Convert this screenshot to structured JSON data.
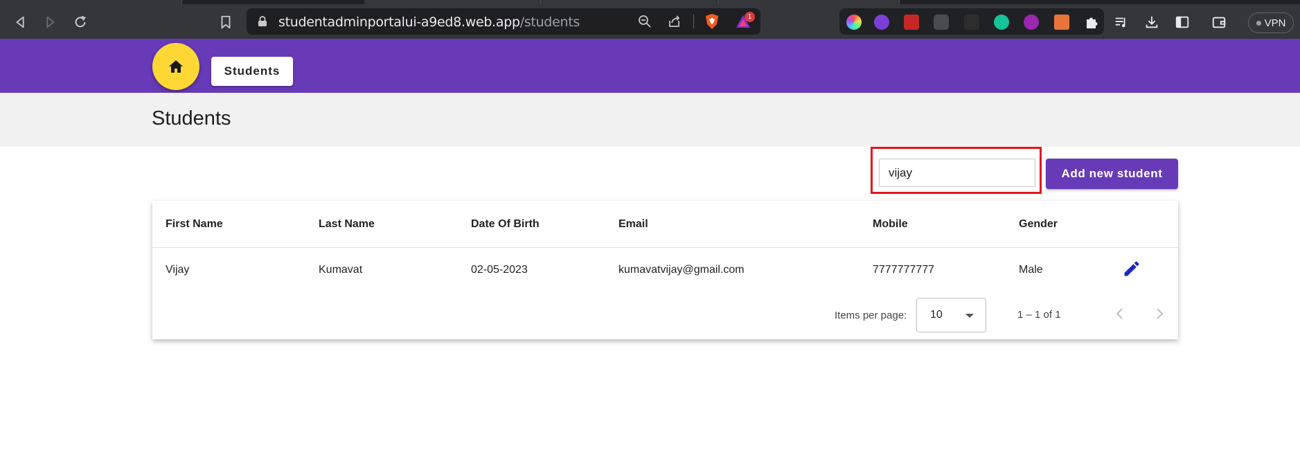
{
  "browser": {
    "url_host": "studentadminportalui-a9ed8.web.app",
    "url_path": "/students",
    "notification_badge": "1",
    "vpn_label": "VPN"
  },
  "header": {
    "nav_button_label": "Students"
  },
  "page": {
    "title": "Students"
  },
  "toolbar": {
    "search_value": "vijay",
    "add_button_label": "Add new student"
  },
  "table": {
    "columns": [
      "First Name",
      "Last Name",
      "Date Of Birth",
      "Email",
      "Mobile",
      "Gender"
    ],
    "rows": [
      {
        "first_name": "Vijay",
        "last_name": "Kumavat",
        "dob": "02-05-2023",
        "email": "kumavatvijay@gmail.com",
        "mobile": "7777777777",
        "gender": "Male"
      }
    ]
  },
  "paginator": {
    "items_per_page_label": "Items per page:",
    "items_per_page_value": "10",
    "range_label": "1 – 1 of 1"
  },
  "colors": {
    "primary": "#673ab7",
    "accent": "#fdd835",
    "highlight": "#e8141c",
    "edit_icon": "#1a27c9"
  }
}
